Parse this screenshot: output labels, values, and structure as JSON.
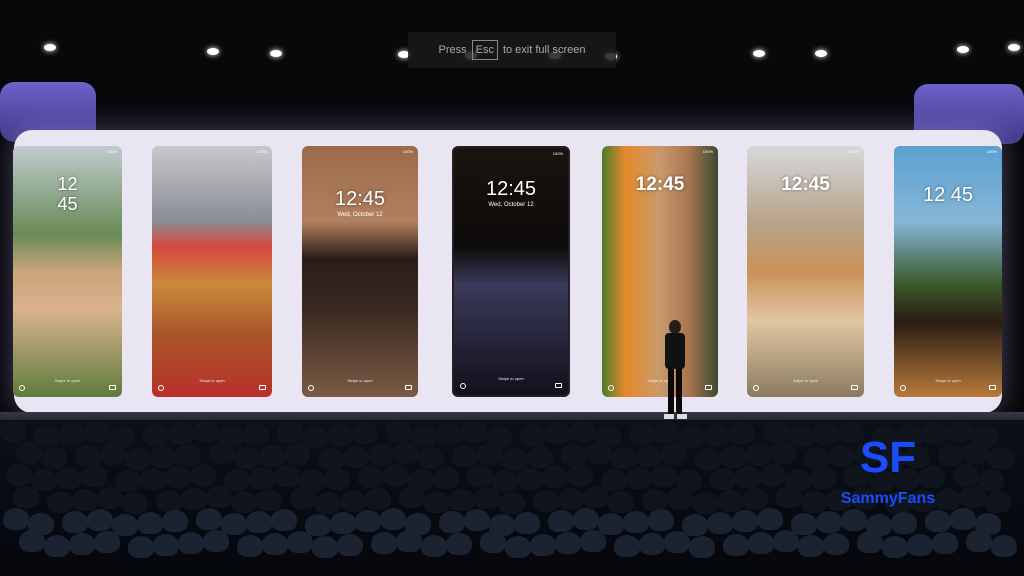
{
  "overlay": {
    "press": "Press",
    "key": "Esc",
    "message": "to exit full screen"
  },
  "panels": [
    {
      "clock": "12\n45",
      "date": "",
      "swipe": "Swipe to open"
    },
    {
      "clock": "",
      "date": "",
      "swipe": "Swipe to open"
    },
    {
      "clock": "12:45",
      "date": "Wed, October 12",
      "swipe": "Swipe to open"
    },
    {
      "clock": "12:45",
      "date": "Wed, October 12",
      "swipe": "Swipe to open"
    },
    {
      "clock": "12:45",
      "date": "",
      "swipe": "Swipe to open"
    },
    {
      "clock": "12:45",
      "date": "",
      "swipe": "Swipe to open"
    },
    {
      "clock": "12 45",
      "date": "",
      "swipe": "Swipe to open"
    }
  ],
  "status_text": "100%",
  "watermark": {
    "mark": "SF",
    "name": "SammyFans",
    "color": "#1a4cff"
  }
}
